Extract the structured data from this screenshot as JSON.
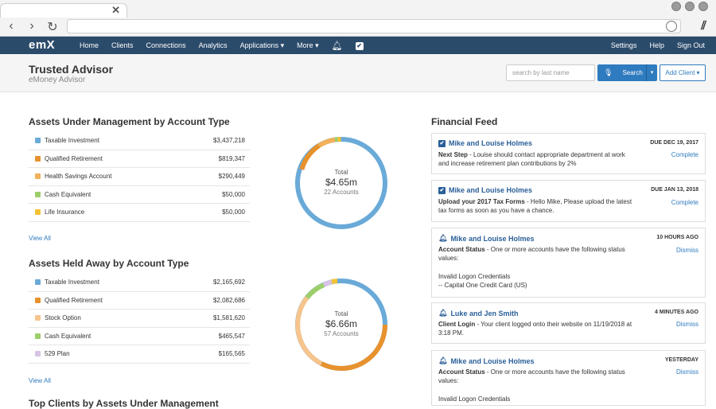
{
  "browser": {
    "tab_close": "✕"
  },
  "nav": {
    "logo": "emX",
    "left_items": [
      "Home",
      "Clients",
      "Connections",
      "Analytics",
      "Applications ▾",
      "More ▾"
    ],
    "right_items": [
      "Settings",
      "Help",
      "Sign Out"
    ]
  },
  "header": {
    "title": "Trusted Advisor",
    "subtitle": "eMoney Advisor",
    "search_placeholder": "search by last name",
    "search_button": "Search",
    "add_client_button": "Add Client ▾"
  },
  "aum": {
    "title": "Assets Under Management by Account Type",
    "view_all": "View All",
    "rows": [
      {
        "name": "Taxable Investment",
        "value": "$3,437,218",
        "color": "#6aaad8"
      },
      {
        "name": "Qualified Retirement",
        "value": "$819,347",
        "color": "#e8922e"
      },
      {
        "name": "Health Savings Account",
        "value": "$290,449",
        "color": "#f2b15a"
      },
      {
        "name": "Cash Equivalent",
        "value": "$50,000",
        "color": "#9ccf6a"
      },
      {
        "name": "Life Insurance",
        "value": "$50,000",
        "color": "#f3c233"
      }
    ],
    "donut": {
      "total_label": "Total",
      "amount": "$4.65m",
      "accounts": "22 Accounts"
    }
  },
  "held_away": {
    "title": "Assets Held Away by Account Type",
    "view_all": "View All",
    "rows": [
      {
        "name": "Taxable Investment",
        "value": "$2,165,692",
        "color": "#6aaad8"
      },
      {
        "name": "Qualified Retirement",
        "value": "$2,082,686",
        "color": "#e8922e"
      },
      {
        "name": "Stock Option",
        "value": "$1,581,620",
        "color": "#f6c48d"
      },
      {
        "name": "Cash Equivalent",
        "value": "$465,547",
        "color": "#9ccf6a"
      },
      {
        "name": "529 Plan",
        "value": "$165,565",
        "color": "#d8c3e6"
      }
    ],
    "donut": {
      "total_label": "Total",
      "amount": "$6.66m",
      "accounts": "57 Accounts"
    }
  },
  "bottom_cut_title": "Top Clients by Assets Under Management",
  "feed": {
    "title": "Financial Feed",
    "cards": [
      {
        "icon": "check",
        "name": "Mike and Louise Holmes",
        "date": "DUE DEC 19, 2017",
        "action": "Complete",
        "label": "Next Step",
        "text": " - Louise should contact appropriate department at work and increase retirement plan contributions by 2%",
        "extra": []
      },
      {
        "icon": "check",
        "name": "Mike and Louise Holmes",
        "date": "DUE JAN 13, 2018",
        "action": "Complete",
        "label": "Upload your 2017 Tax Forms",
        "text": " - Hello Mike, Please upload the latest tax forms as soon as you have a chance.",
        "extra": []
      },
      {
        "icon": "bell",
        "name": "Mike and Louise Holmes",
        "date": "10 HOURS AGO",
        "action": "Dismiss",
        "label": "Account Status",
        "text": " - One or more accounts have the following status values:",
        "extra": [
          "Invalid Logon Credentials",
          "-- Capital One Credit Card (US)"
        ]
      },
      {
        "icon": "bell",
        "name": "Luke and Jen Smith",
        "date": "4 MINUTES AGO",
        "action": "Dismiss",
        "label": "Client Login",
        "text": " - Your client logged onto their website on 11/19/2018 at 3:18 PM.",
        "extra": []
      },
      {
        "icon": "bell",
        "name": "Mike and Louise Holmes",
        "date": "YESTERDAY",
        "action": "Dismiss",
        "label": "Account Status",
        "text": " - One or more accounts have the following status values:",
        "extra": [
          "Invalid Logon Credentials"
        ]
      }
    ]
  }
}
